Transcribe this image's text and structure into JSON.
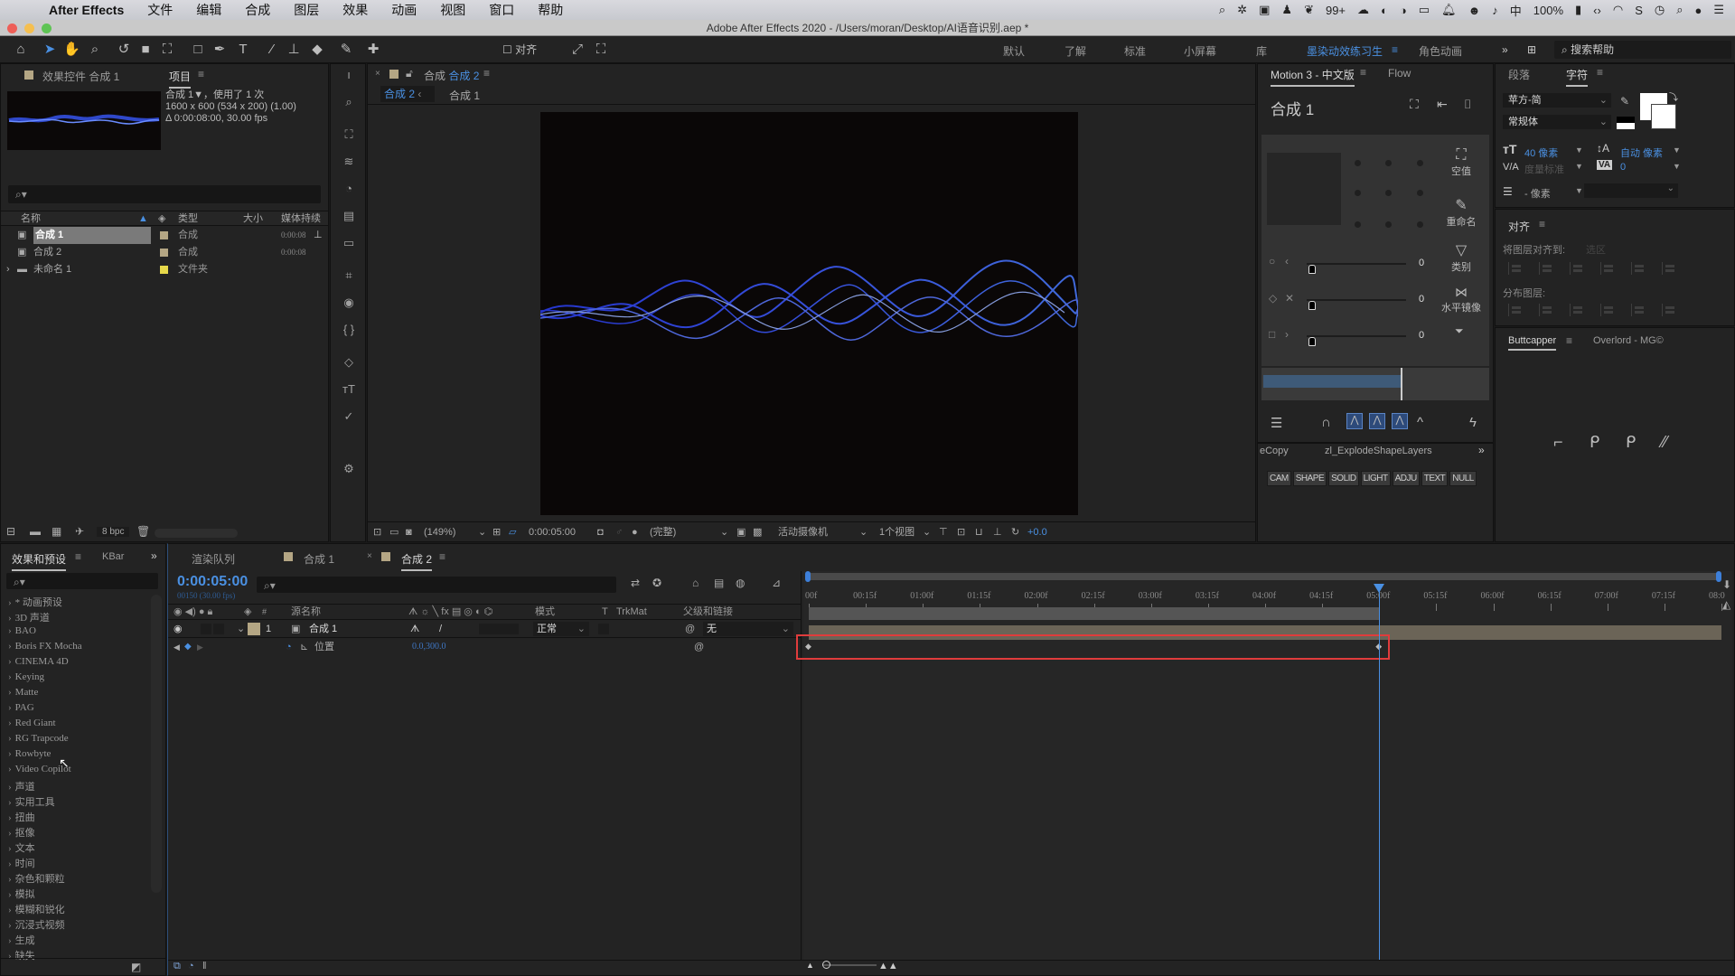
{
  "menubar": {
    "app_name": "After Effects",
    "items": [
      "文件",
      "编辑",
      "合成",
      "图层",
      "效果",
      "动画",
      "视图",
      "窗口",
      "帮助"
    ],
    "status": {
      "notifications": "99+",
      "battery": "100%"
    }
  },
  "window": {
    "title": "Adobe After Effects 2020 - /Users/moran/Desktop/AI语音识别.aep *"
  },
  "toolbar": {
    "snap_label": "对齐",
    "workspaces": [
      "默认",
      "了解",
      "标准",
      "小屏幕",
      "库",
      "墨染动效练习生",
      "角色动画"
    ],
    "active_workspace": "墨染动效练习生",
    "search_placeholder": "搜索帮助"
  },
  "project_panel": {
    "tabs": [
      "效果控件 合成 1",
      "项目"
    ],
    "info_name": "合成 1▼，使用了 1 次",
    "info_size": "1600 x 600  (534 x 200) (1.00)",
    "info_duration": "Δ 0:00:08:00, 30.00 fps",
    "columns": [
      "名称",
      "类型",
      "大小",
      "媒体持续"
    ],
    "items": [
      {
        "name": "合成 1",
        "type": "合成",
        "duration": "0:00:08",
        "color": "#b4a684",
        "selected": true
      },
      {
        "name": "合成 2",
        "type": "合成",
        "duration": "0:00:08",
        "color": "#b4a684",
        "selected": false
      },
      {
        "name": "未命名 1",
        "type": "文件夹",
        "duration": "",
        "color": "#e6d84a",
        "selected": false
      }
    ],
    "bpc": "8 bpc"
  },
  "viewer": {
    "tab_prefix": "合成",
    "tab_name": "合成 2",
    "breadcrumb": [
      "合成 2",
      "合成 1"
    ],
    "zoom": "(149%)",
    "timecode": "0:00:05:00",
    "resolution": "(完整)",
    "camera": "活动摄像机",
    "views": "1个视图",
    "exposure": "+0.0"
  },
  "motion_panel": {
    "tabs": [
      "Motion 3 - 中文版",
      "Flow"
    ],
    "comp_name": "合成 1",
    "side_buttons": [
      "空值",
      "重命名",
      "类别",
      "水平镜像"
    ],
    "slider_values": [
      "0",
      "0",
      "0"
    ],
    "scripts_row": [
      "eCopy",
      "zl_ExplodeShapeLayers"
    ],
    "fx_buttons": [
      "CAM",
      "SHAPE",
      "SOLID",
      "LIGHT",
      "ADJU",
      "TEXT",
      "NULL"
    ]
  },
  "character_panel": {
    "tabs": [
      "段落",
      "字符"
    ],
    "font": "苹方-简",
    "style": "常规体",
    "size": "40 像素",
    "leading": "自动 像素",
    "kerning": "度量标准",
    "tracking": "0",
    "stroke": "- 像素"
  },
  "align_panel": {
    "title": "对齐",
    "align_to_label": "将图层对齐到:",
    "align_to_value": "选区",
    "distribute_label": "分布图层:"
  },
  "buttcapper_panel": {
    "tabs": [
      "Buttcapper",
      "Overlord - MG©"
    ]
  },
  "effects_panel": {
    "tabs": [
      "效果和预设",
      "KBar"
    ],
    "items": [
      "* 动画预设",
      "3D 声道",
      "BAO",
      "Boris FX Mocha",
      "CINEMA 4D",
      "Keying",
      "Matte",
      "PAG",
      "Red Giant",
      "RG Trapcode",
      "Rowbyte",
      "Video Copilot",
      "声道",
      "实用工具",
      "扭曲",
      "抠像",
      "文本",
      "时间",
      "杂色和颗粒",
      "模拟",
      "模糊和锐化",
      "沉浸式视频",
      "生成",
      "缺失"
    ]
  },
  "timeline": {
    "tabs": [
      "渲染队列",
      "合成 1",
      "合成 2"
    ],
    "active_tab": "合成 2",
    "timecode": "0:00:05:00",
    "frame_info": "00150 (30.00 fps)",
    "columns": {
      "source": "源名称",
      "mode": "模式",
      "trkmat": "TrkMat",
      "parent": "父级和链接"
    },
    "layer": {
      "index": "1",
      "name": "合成 1",
      "mode": "正常",
      "parent": "无"
    },
    "property": {
      "name": "位置",
      "value": "0.0,300.0"
    },
    "ruler": [
      "00f",
      "00:15f",
      "01:00f",
      "01:15f",
      "02:00f",
      "02:15f",
      "03:00f",
      "03:15f",
      "04:00f",
      "04:15f",
      "05:00f",
      "05:15f",
      "06:00f",
      "06:15f",
      "07:00f",
      "07:15f",
      "08:0"
    ],
    "current_time_sec": 5,
    "duration_sec": 8,
    "keyframes_sec": [
      0,
      5
    ],
    "highlight_color": "#e03c3c"
  },
  "colors": {
    "accent": "#4a90e2",
    "wave": "#3a5cff"
  }
}
